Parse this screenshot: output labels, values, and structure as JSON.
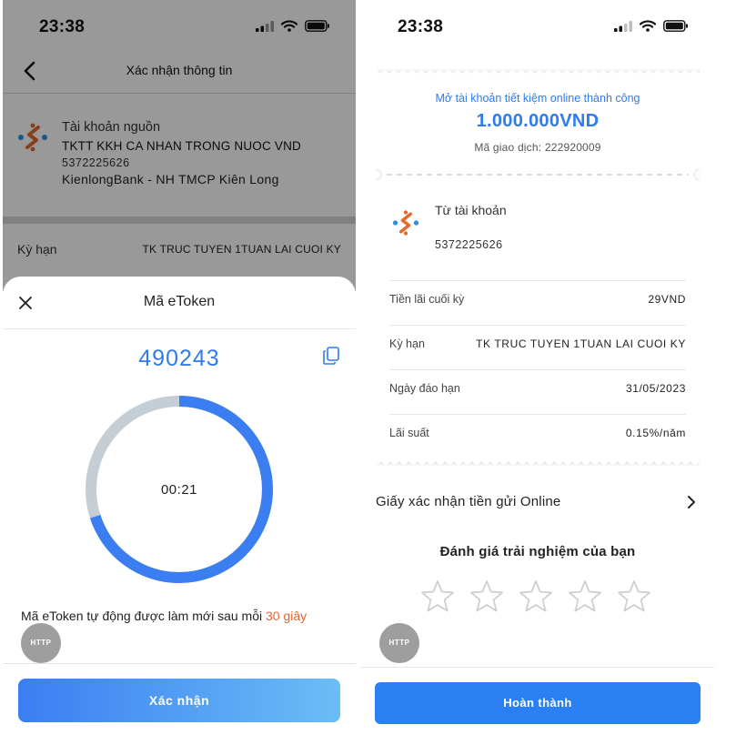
{
  "colors": {
    "accent_blue": "#2f7bf0",
    "highlight_orange": "#e4642f",
    "ring_track": "#c5ced4",
    "ring_progress": "#3a7ef2",
    "logo_orange": "#e36a2e",
    "logo_blue": "#2f8ee0"
  },
  "left_screen": {
    "status_time": "23:38",
    "header_title": "Xác nhận thông tin",
    "source_account": {
      "label": "Tài khoản nguồn",
      "name": "TKTT KKH CA NHAN TRONG NUOC VND",
      "number": "5372225626",
      "bank": "KienlongBank - NH TMCP Kiên Long"
    },
    "term_row": {
      "label": "Kỳ hạn",
      "value": "TK TRUC TUYEN 1TUAN LAI CUOI KY"
    },
    "sheet": {
      "title": "Mã eToken",
      "otp_code": "490243",
      "countdown": "00:21",
      "countdown_fraction_remaining": 0.7,
      "note_prefix": "Mã eToken tự động được làm mới sau mỗi ",
      "note_highlight": "30 giây",
      "http_badge": "HTTP",
      "confirm_label": "Xác nhận"
    },
    "icons": [
      "signal-icon",
      "wifi-icon",
      "battery-icon",
      "back-icon",
      "bank-logo-icon",
      "close-icon",
      "copy-icon"
    ]
  },
  "right_screen": {
    "status_time": "23:38",
    "receipt": {
      "success_text": "Mở tài khoản tiết kiệm online thành công",
      "amount": "1.000.000VND",
      "transaction_id": "Mã giao dịch: 222920009",
      "from_label": "Từ tài khoản",
      "from_number": "5372225626",
      "rows": [
        {
          "label": "Tiền lãi cuối kỳ",
          "value": "29VND"
        },
        {
          "label": "Kỳ hạn",
          "value": "TK TRUC TUYEN 1TUAN LAI CUOI KY"
        },
        {
          "label": "Ngày đáo hạn",
          "value": "31/05/2023"
        },
        {
          "label": "Lãi suất",
          "value": "0.15%/năm"
        }
      ]
    },
    "certificate_link": "Giấy xác nhận tiền gửi Online",
    "rating_title": "Đánh giá trải nghiệm của bạn",
    "rating": {
      "value": 0,
      "max": 5
    },
    "http_badge": "HTTP",
    "done_label": "Hoàn thành",
    "icons": [
      "signal-icon",
      "wifi-icon",
      "battery-icon",
      "bank-logo-icon",
      "chevron-right-icon",
      "star-icon"
    ]
  }
}
